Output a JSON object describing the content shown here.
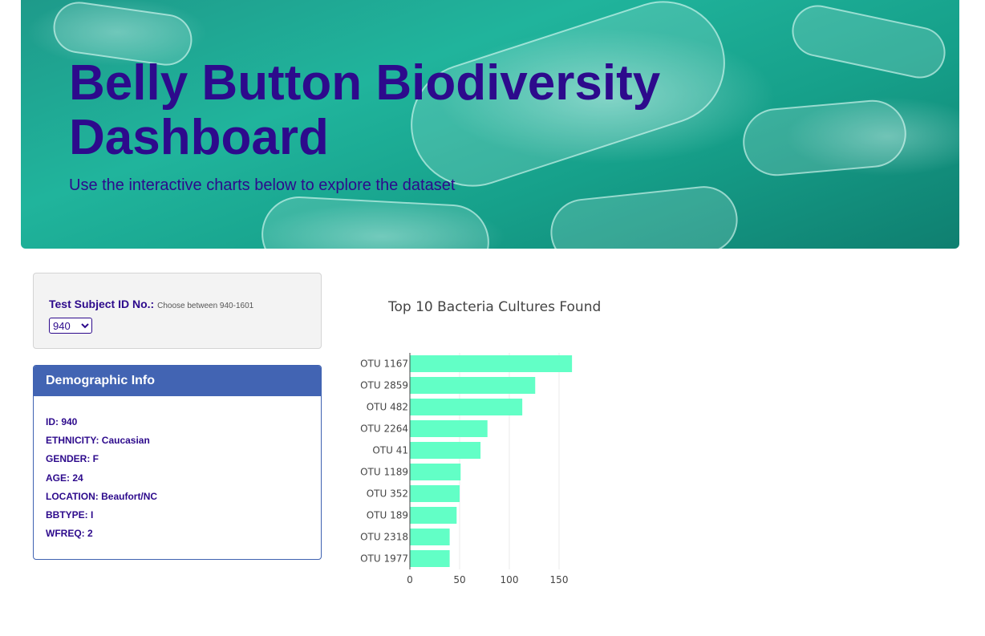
{
  "header": {
    "title": "Belly Button Biodiversity Dashboard",
    "subtitle": "Use the interactive charts below to explore the dataset"
  },
  "selector": {
    "label": "Test Subject ID No.:",
    "hint": "Choose between 940-1601",
    "selected_value": "940"
  },
  "demographics": {
    "title": "Demographic Info",
    "rows": [
      "ID: 940",
      "ETHNICITY: Caucasian",
      "GENDER: F",
      "AGE: 24",
      "LOCATION: Beaufort/NC",
      "BBTYPE: I",
      "WFREQ: 2"
    ]
  },
  "colors": {
    "bar": "#62ffc6",
    "title_text": "#2d0a8c",
    "panel_header": "#4264b3"
  },
  "chart_data": {
    "type": "bar",
    "orientation": "horizontal",
    "title": "Top 10 Bacteria Cultures Found",
    "categories": [
      "OTU 1167",
      "OTU 2859",
      "OTU 482",
      "OTU 2264",
      "OTU 41",
      "OTU 1189",
      "OTU 352",
      "OTU 189",
      "OTU 2318",
      "OTU 1977"
    ],
    "values": [
      163,
      126,
      113,
      78,
      71,
      51,
      50,
      47,
      40,
      40
    ],
    "xticks": [
      0,
      50,
      100,
      150
    ],
    "xlim": [
      0,
      165
    ],
    "grid": true
  }
}
